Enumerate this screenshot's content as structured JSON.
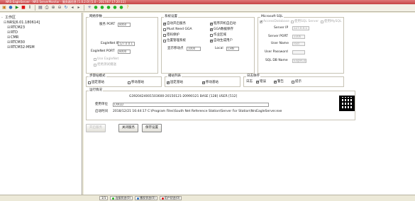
{
  "window": {
    "title": "NRS-EagleServer - NRS ServerMonitor - 服务器信息 [1.0.2.0] [1.0 - 2017/07 17:20:11]"
  },
  "toolbar": {
    "icons": [
      "new-icon",
      "open-icon",
      "play-icon",
      "stop-icon",
      "pause-icon",
      "save-icon",
      "print-icon",
      "zoom-in-icon",
      "zoom-out-icon",
      "refresh-icon",
      "back-icon",
      "forward-icon",
      "satellite-icon",
      "green-light-icon",
      "green-light-icon",
      "green-light-icon",
      "green-light-icon",
      "green-light-icon",
      "help-icon"
    ]
  },
  "tree": {
    "root": "工作区",
    "server": "NRS[6.01.180614]",
    "children": [
      "RTCM23",
      "RTD",
      "CMR",
      "RTCM30",
      "RTCM32-MSM"
    ]
  },
  "service": {
    "group_label": "网络参数",
    "port_label": "服务 PORT",
    "port_value": "8060",
    "eagle_ip_label": "EagleNet IP",
    "eagle_ip_value": "127.0.0.1",
    "eagle_port_label": "EagleNet PORT",
    "eagle_port_value": "8000",
    "use_eaglenet": "Use EagleNet",
    "net_push_label": "拒绝测试播送"
  },
  "system": {
    "group_label": "系统设置",
    "auto_start_service": "自动开启服务",
    "must_need_gga": "Must Need GGA",
    "password_protect": "密码保护",
    "position_system": "位置管理系统",
    "program_autostart": "程序开机自启动",
    "gga_save": "GGA数据保存",
    "work_area": "作业区域",
    "auto_gen_user": "自动生成用户",
    "display_move_label": "显示移动点",
    "display_move_value": "1000",
    "local_label": "Local",
    "local_value": "CHN"
  },
  "sql": {
    "group_label": "Microsoft SQL",
    "access_db": "AccessDatabase",
    "use_sql_server": "使用SQL Server",
    "use_mysql": "使用MySQL",
    "server_ip_label": "Server IP",
    "server_ip_value": "127.0.0.1",
    "server_port_label": "Server PORT",
    "server_port_value": "3306",
    "user_name_label": "User Name",
    "user_name_value": "root",
    "user_password_label": "User Password",
    "user_password_value": "",
    "db_name_label": "SQL DB Name",
    "db_name_value": "EagleCors"
  },
  "download": {
    "group_label": "步骤站模式",
    "fixed_base": "固定基站",
    "mobile_base": "移动基站"
  },
  "list_mode": {
    "group_label": "播站列表",
    "fixed_base": "固定基站",
    "mobile_base": "移动基站"
  },
  "log": {
    "group_label": "日志保存",
    "prefix": "日志",
    "error": "错误",
    "warning": "警告",
    "info": "提示"
  },
  "runtime": {
    "group_label": "运行情况",
    "license_line": "G3920424001503600-20150121-20990121  BASE [128] USER [512]",
    "user_unit_label": "使用单位",
    "user_unit_value": "LXKLD",
    "start_info_label": "启动时间",
    "start_info_value": "2018/12/21 16:44:17 C:\\Program Files\\South Net Reference Station\\Server For Station\\NrsEagleServer.exe"
  },
  "buttons": {
    "start": "开启服务",
    "stop": "关闭服务",
    "save": "保存设置"
  },
  "status": {
    "items": [
      "1/1",
      "连接状态(0)",
      "播发状态(0)",
      "用户状态(0)"
    ]
  }
}
